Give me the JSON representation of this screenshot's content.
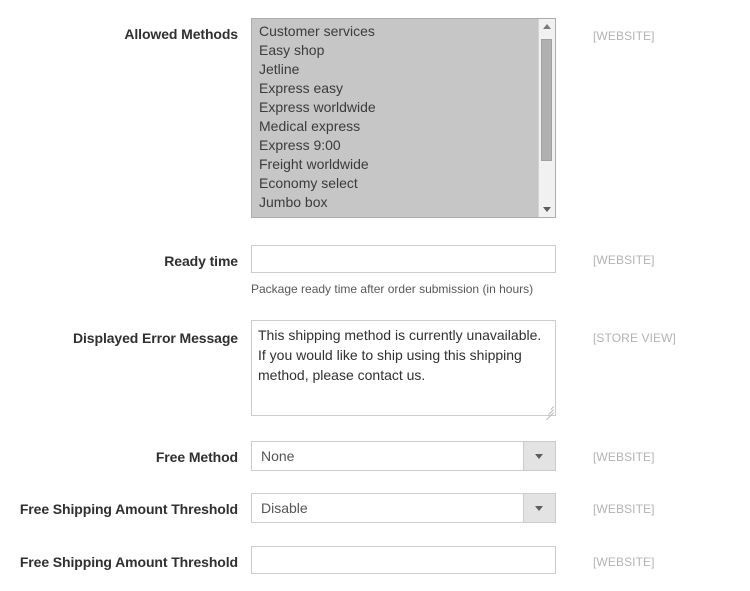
{
  "form": {
    "rows": [
      {
        "label": "Allowed Methods",
        "scope": "[WEBSITE]",
        "type": "multiselect",
        "options": [
          "Customer services",
          "Easy shop",
          "Jetline",
          "Express easy",
          "Express worldwide",
          "Medical express",
          "Express 9:00",
          "Freight worldwide",
          "Economy select",
          "Jumbo box"
        ]
      },
      {
        "label": "Ready time",
        "scope": "[WEBSITE]",
        "type": "text",
        "value": "",
        "hint": "Package ready time after order submission (in hours)"
      },
      {
        "label": "Displayed Error Message",
        "scope": "[STORE VIEW]",
        "type": "textarea",
        "value": "This shipping method is currently unavailable. If you would like to ship using this shipping method, please contact us."
      },
      {
        "label": "Free Method",
        "scope": "[WEBSITE]",
        "type": "select",
        "value": "None"
      },
      {
        "label": "Free Shipping Amount Threshold",
        "scope": "[WEBSITE]",
        "type": "select",
        "value": "Disable"
      },
      {
        "label": "Free Shipping Amount Threshold",
        "scope": "[WEBSITE]",
        "type": "text",
        "value": ""
      }
    ]
  },
  "colors": {
    "page_background": "#ffffff",
    "label_text": "#303030",
    "scope_text": "#b3b3b3",
    "multiselect_background": "#c6c6c6",
    "input_border": "#cccccc",
    "select_button": "#e3e3e3"
  }
}
